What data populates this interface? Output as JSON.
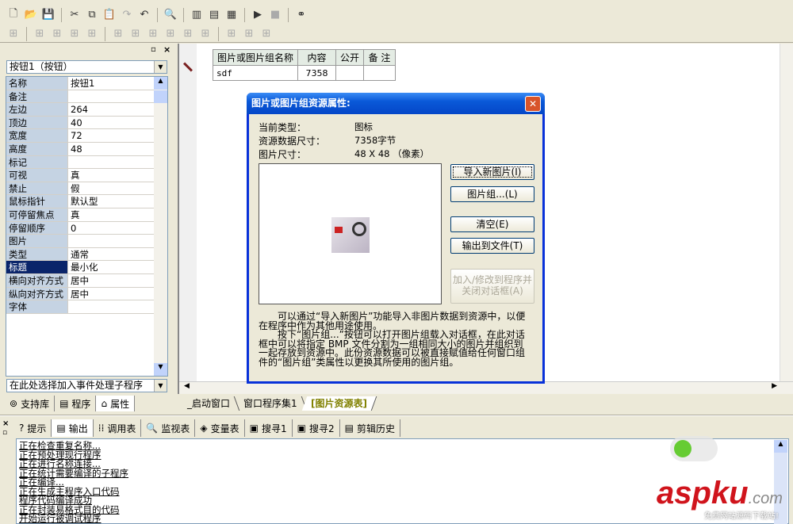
{
  "toolbar1": [
    "new-file-icon",
    "open-folder-icon",
    "save-icon",
    "cut-icon",
    "copy-icon",
    "paste-icon",
    "redo-icon",
    "undo-icon",
    "find-icon",
    "layout1-icon",
    "layout2-icon",
    "layout3-icon",
    "run-icon",
    "stop-icon",
    "binoculars-icon"
  ],
  "toolbar2": [
    "align-grid-icon",
    "align-left-icon",
    "align-right-icon",
    "align-top-icon",
    "align-bottom-icon",
    "center-h-icon",
    "center-v-icon",
    "same-top-icon",
    "same-left-icon",
    "space-h-icon",
    "space-v-icon",
    "same-width-icon",
    "same-height-icon",
    "same-size-icon"
  ],
  "left_panel": {
    "component_combo": "按钮1（按钮）",
    "properties": [
      {
        "name": "名称",
        "value": "按钮1"
      },
      {
        "name": "备注",
        "value": ""
      },
      {
        "name": "左边",
        "value": "264"
      },
      {
        "name": "顶边",
        "value": "40"
      },
      {
        "name": "宽度",
        "value": "72"
      },
      {
        "name": "高度",
        "value": "48"
      },
      {
        "name": "标记",
        "value": ""
      },
      {
        "name": "可视",
        "value": "真"
      },
      {
        "name": "禁止",
        "value": "假"
      },
      {
        "name": "鼠标指针",
        "value": "默认型"
      },
      {
        "name": "可停留焦点",
        "value": "真"
      },
      {
        "name": "  停留顺序",
        "value": "0"
      },
      {
        "name": "图片",
        "value": ""
      },
      {
        "name": "类型",
        "value": "通常"
      },
      {
        "name": "标题",
        "value": "最小化",
        "selected": true
      },
      {
        "name": "横向对齐方式",
        "value": "居中"
      },
      {
        "name": "纵向对齐方式",
        "value": "居中"
      },
      {
        "name": "字体",
        "value": ""
      }
    ],
    "event_combo": "在此处选择加入事件处理子程序",
    "tabs": [
      "支持库",
      "程序",
      "属性"
    ],
    "active_tab": "属性"
  },
  "resource_table": {
    "headers": [
      "图片或图片组名称",
      "内容",
      "公开",
      "备 注"
    ],
    "rows": [
      [
        "sdf",
        "7358",
        "",
        ""
      ]
    ]
  },
  "editor_tabs": [
    "_启动窗口",
    "窗口程序集1",
    "[图片资源表]"
  ],
  "dialog": {
    "title": "图片或图片组资源属性:",
    "info": [
      {
        "label": "当前类型：",
        "value": "图标"
      },
      {
        "label": "资源数据尺寸：",
        "value": "7358字节"
      },
      {
        "label": "图片尺寸：",
        "value": "48 X 48 （像素）"
      }
    ],
    "buttons": {
      "import": "导入新图片(I)",
      "group": "图片组...(L)",
      "clear": "清空(E)",
      "export": "输出到文件(T)",
      "apply": "加入/修改到程序并关闭对话框(A)"
    },
    "help1": "　　可以通过“导入新图片”功能导入非图片数据到资源中，以便在程序中作为其他用途使用。",
    "help2": "　　按下“图片组...”按钮可以打开图片组载入对话框，在此对话框中可以将指定 BMP 文件分割为一组相同大小的图片并组织到一起存放到资源中。此份资源数据可以被直接赋值给任何窗口组件的“图片组”类属性以更换其所使用的图片组。"
  },
  "bottom_tabs": [
    "提示",
    "输出",
    "调用表",
    "监视表",
    "变量表",
    "搜寻1",
    "搜寻2",
    "剪辑历史"
  ],
  "bottom_active": "输出",
  "output_lines": [
    "正在检查重复名称...",
    "正在预处理现行程序",
    "正在进行名称连接...",
    "正在统计需要编译的子程序",
    "正在编译...",
    "正在生成主程序入口代码",
    "程序代码编译成功",
    "正在封装易格式目的代码",
    "开始运行被调试程序"
  ],
  "watermark": {
    "brand": "aspku",
    "suffix": ".com",
    "tagline": "免费网站源码下载站!"
  },
  "colors": {
    "title_bar": "#0a59d8",
    "selection": "#0a246a",
    "close": "#d8542a",
    "watermark": "#d0141c"
  }
}
